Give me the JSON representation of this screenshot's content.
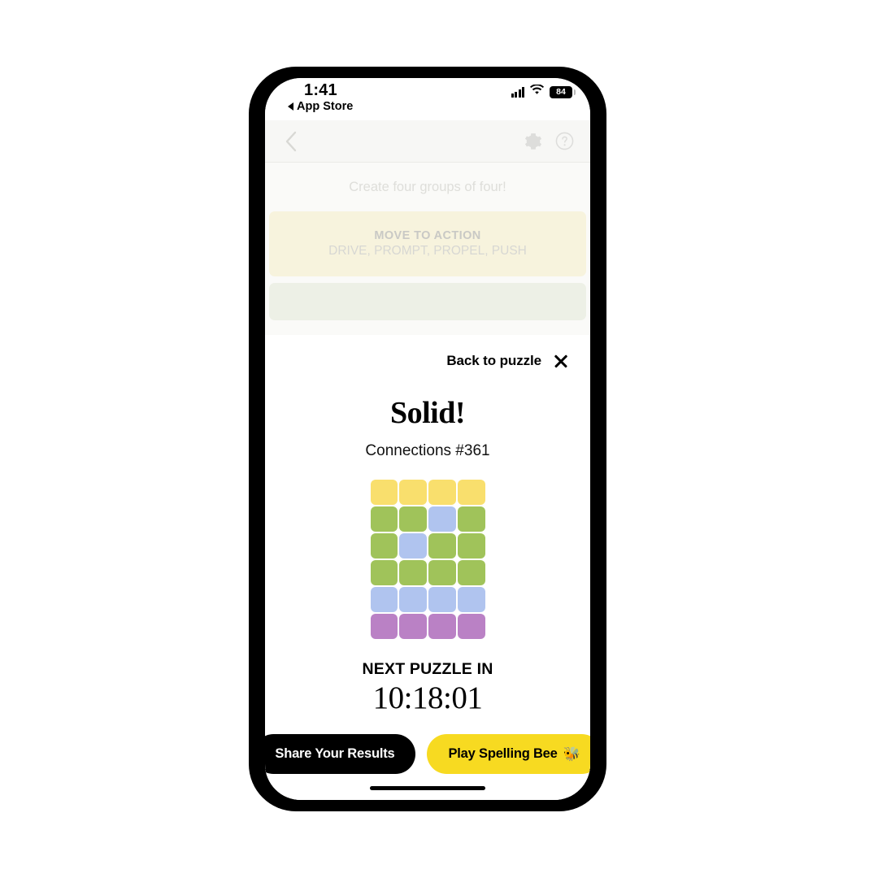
{
  "status_bar": {
    "time": "1:41",
    "back_app": "App Store",
    "battery_level": "84",
    "signal_icon": "signal-bars-icon",
    "wifi_icon": "wifi-icon",
    "battery_icon": "battery-icon"
  },
  "game": {
    "nav": {
      "back_icon": "chevron-left-icon",
      "settings_icon": "gear-icon",
      "help_icon": "question-mark-circle-icon"
    },
    "subtitle": "Create four groups of four!",
    "solved_groups": [
      {
        "title": "MOVE TO ACTION",
        "words": "DRIVE, PROMPT, PROPEL, PUSH",
        "color": "yellow"
      },
      {
        "title": "",
        "words": "",
        "color": "green"
      }
    ]
  },
  "modal": {
    "back_label": "Back to puzzle",
    "close_icon": "close-icon",
    "title": "Solid!",
    "puzzle_id": "Connections #361",
    "timer_label": "NEXT PUZZLE IN",
    "timer_value": "10:18:01",
    "share_button": "Share Your Results",
    "spelling_bee_button": "Play Spelling Bee",
    "bee_icon": "🐝"
  },
  "colors": {
    "yellow": "#f9df6d",
    "green": "#a0c35a",
    "blue": "#b0c4ef",
    "purple": "#ba81c5",
    "brand_yellow": "#f7da21",
    "dark": "#000000"
  },
  "chart_data": {
    "type": "heatmap",
    "title": "Connections #361 result grid",
    "legend": {
      "Y": "yellow",
      "G": "green",
      "B": "blue",
      "P": "purple"
    },
    "rows": [
      [
        "Y",
        "Y",
        "Y",
        "Y"
      ],
      [
        "G",
        "G",
        "B",
        "G"
      ],
      [
        "G",
        "B",
        "G",
        "G"
      ],
      [
        "G",
        "G",
        "G",
        "G"
      ],
      [
        "B",
        "B",
        "B",
        "B"
      ],
      [
        "P",
        "P",
        "P",
        "P"
      ]
    ]
  }
}
